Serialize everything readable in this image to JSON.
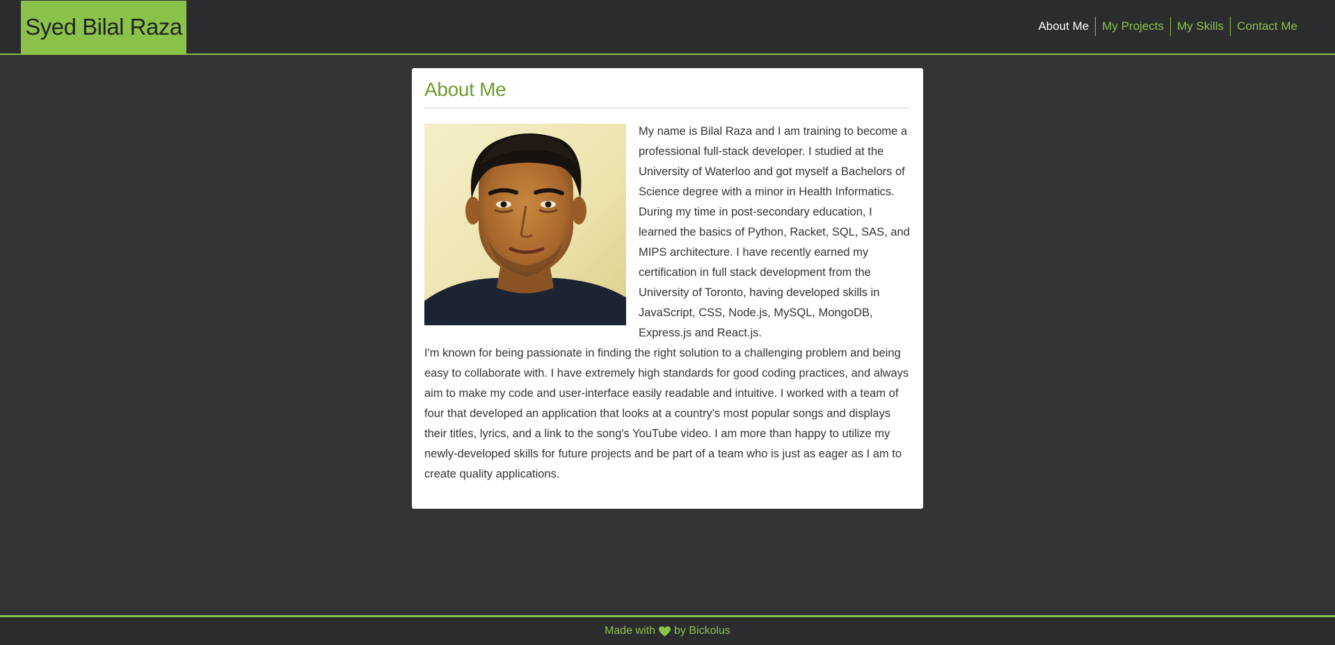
{
  "header": {
    "brand": "Syed Bilal Raza",
    "nav": [
      {
        "label": "About Me",
        "active": true
      },
      {
        "label": "My Projects",
        "active": false
      },
      {
        "label": "My Skills",
        "active": false
      },
      {
        "label": "Contact Me",
        "active": false
      }
    ]
  },
  "about": {
    "title": "About Me",
    "photo_icon": "portrait-photo",
    "paragraph_1": "My name is Bilal Raza and I am training to become a professional full-stack developer. I studied at the University of Waterloo and got myself a Bachelors of Science degree with a minor in Health Informatics. During my time in post-secondary education, I learned the basics of Python, Racket, SQL, SAS, and MIPS architecture. I have recently earned my certification in full stack development from the University of Toronto, having developed skills in JavaScript, CSS, Node.js, MySQL, MongoDB, Express.js and React.js.",
    "paragraph_2": "I'm known for being passionate in finding the right solution to a challenging problem and being easy to collaborate with. I have extremely high standards for good coding practices, and always aim to make my code and user-interface easily readable and intuitive. I worked with a team of four that developed an application that looks at a country's most popular songs and displays their titles, lyrics, and a link to the song's YouTube video. I am more than happy to utilize my newly-developed skills for future projects and be part of a team who is just as eager as I am to create quality applications."
  },
  "footer": {
    "made_with": "Made with",
    "heart_icon": "heart-icon",
    "by": "by Bickolus"
  },
  "colors": {
    "accent": "#8bc34a",
    "title": "#6e9b2e",
    "page_bg": "#333333",
    "bar_bg": "#2a2c2e",
    "card_bg": "#ffffff"
  }
}
